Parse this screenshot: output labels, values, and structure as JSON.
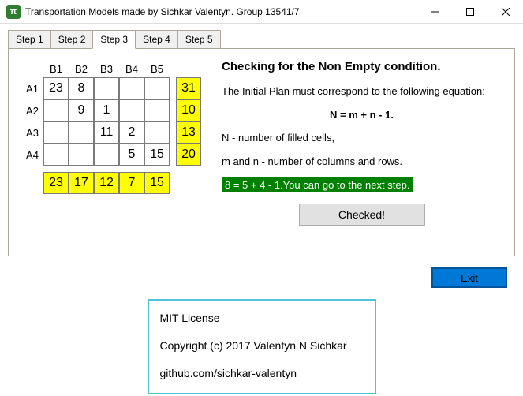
{
  "window": {
    "title": "Transportation Models made by Sichkar Valentyn. Group 13541/7",
    "icon_glyph": "π"
  },
  "tabs": [
    "Step 1",
    "Step 2",
    "Step 3",
    "Step 4",
    "Step 5"
  ],
  "active_tab_index": 2,
  "table": {
    "col_headers": [
      "B1",
      "B2",
      "B3",
      "B4",
      "B5"
    ],
    "row_headers": [
      "A1",
      "A2",
      "A3",
      "A4"
    ],
    "cells": [
      [
        "23",
        "8",
        "",
        "",
        ""
      ],
      [
        "",
        "9",
        "1",
        "",
        ""
      ],
      [
        "",
        "",
        "11",
        "2",
        ""
      ],
      [
        "",
        "",
        "",
        "5",
        "15"
      ]
    ],
    "row_totals": [
      "31",
      "10",
      "13",
      "20"
    ],
    "col_totals": [
      "23",
      "17",
      "12",
      "7",
      "15"
    ]
  },
  "info": {
    "heading": "Checking for the Non Empty condition.",
    "line1": "The Initial Plan must correspond to the following equation:",
    "equation": "N = m + n - 1.",
    "line2": "N - number of filled cells,",
    "line3": "m and n - number of columns and rows.",
    "result": "8 = 5 + 4 - 1.You can go to the next step.",
    "checked_label": "Checked!"
  },
  "exit_label": "Exit",
  "license": {
    "l1": "MIT License",
    "l2": "Copyright (c) 2017 Valentyn N Sichkar",
    "l3": "github.com/sichkar-valentyn"
  }
}
